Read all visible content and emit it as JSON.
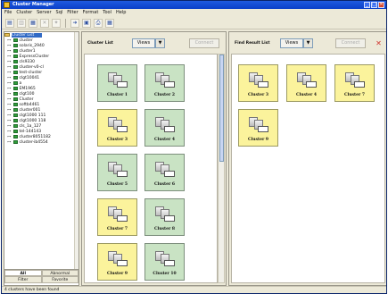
{
  "window": {
    "title": "Cluster Manager"
  },
  "menu": [
    "File",
    "Cluster",
    "Server",
    "Sql",
    "Filter",
    "Format",
    "Tool",
    "Help"
  ],
  "toolbar": {
    "icons": [
      "open-icon",
      "disabled-icon",
      "add-icon",
      "add-disabled-icon",
      "star-icon",
      "login-icon",
      "cluster-icon",
      "print-icon",
      "grid-icon"
    ]
  },
  "tree": {
    "root": "Cluster List",
    "items": [
      "cluster",
      "solaris_2940",
      "cluster1",
      "ExpressCluster",
      "cls9330",
      "cluster-v0-cl",
      "test-cluster",
      "clgt10041",
      "a",
      "EM1965",
      "clgt100",
      "Cluster",
      "softb4461",
      "cluster001",
      "clgt1000 111",
      "clgt1000 118",
      "cls_1a_127",
      "tel-144143",
      "cluster8051182",
      "cluster-ib4554"
    ]
  },
  "left_tabs": {
    "row1": [
      "All",
      "Abnormal"
    ],
    "row2": [
      "Filter",
      "Favorite"
    ]
  },
  "center": {
    "label": "Cluster List",
    "views": "Views",
    "views_arrow": "▼",
    "connect": "Connect",
    "clusters": [
      {
        "name": "Cluster 1",
        "color": "green"
      },
      {
        "name": "Cluster 2",
        "color": "green"
      },
      {
        "name": "Cluster 3",
        "color": "yellow"
      },
      {
        "name": "Cluster 4",
        "color": "green"
      },
      {
        "name": "Cluster 5",
        "color": "green"
      },
      {
        "name": "Cluster 6",
        "color": "green"
      },
      {
        "name": "Cluster 7",
        "color": "yellow"
      },
      {
        "name": "Cluster 8",
        "color": "green"
      },
      {
        "name": "Cluster 9",
        "color": "yellow"
      },
      {
        "name": "Cluster 10",
        "color": "green"
      }
    ]
  },
  "right": {
    "label": "Find Result List",
    "views": "Views",
    "views_arrow": "▼",
    "connect": "Connect",
    "close": "✕",
    "clusters": [
      {
        "name": "Cluster 3",
        "color": "yellow"
      },
      {
        "name": "Cluster 4",
        "color": "yellow"
      },
      {
        "name": "Cluster 7",
        "color": "yellow"
      },
      {
        "name": "Cluster 9",
        "color": "yellow"
      }
    ]
  },
  "status": {
    "text": "4 clusters have been found"
  }
}
